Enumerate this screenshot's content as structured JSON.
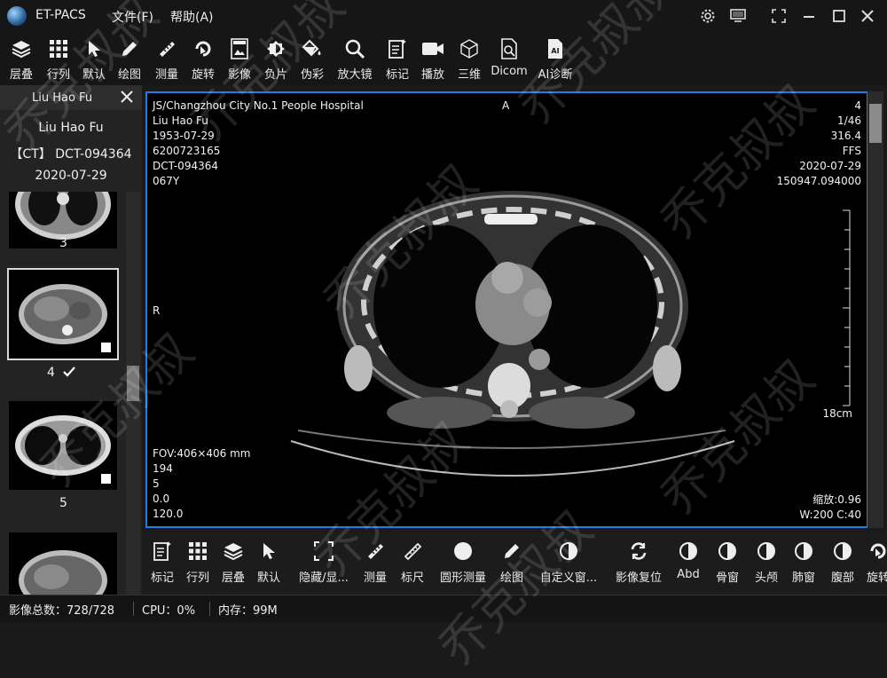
{
  "app": {
    "title": "ET-PACS",
    "menus": [
      "文件(F)",
      "帮助(A)"
    ]
  },
  "toolbar": {
    "items": [
      {
        "label": "层叠",
        "icon": "layers-icon"
      },
      {
        "label": "行列",
        "icon": "grid-icon"
      },
      {
        "label": "默认",
        "icon": "pointer-icon"
      },
      {
        "label": "绘图",
        "icon": "pencil-icon"
      },
      {
        "label": "测量",
        "icon": "measure-icon"
      },
      {
        "label": "旋转",
        "icon": "rotate-icon"
      },
      {
        "label": "影像",
        "icon": "dicom-image-icon"
      },
      {
        "label": "负片",
        "icon": "negative-icon"
      },
      {
        "label": "伪彩",
        "icon": "paint-bucket-icon"
      },
      {
        "label": "放大镜",
        "icon": "magnifier-icon"
      },
      {
        "label": "标记",
        "icon": "annotate-icon"
      },
      {
        "label": "播放",
        "icon": "video-icon"
      },
      {
        "label": "三维",
        "icon": "cube-icon"
      },
      {
        "label": "Dicom",
        "icon": "dicom-file-icon"
      },
      {
        "label": "AI诊断",
        "icon": "ai-icon"
      }
    ]
  },
  "patient": {
    "tab_name": "Liu Hao Fu",
    "name": "Liu Hao Fu",
    "modality_id": "【CT】 DCT-094364",
    "date": "2020-07-29"
  },
  "thumbnails": [
    {
      "number": "3",
      "selected": false
    },
    {
      "number": "4",
      "selected": true
    },
    {
      "number": "5",
      "selected": false
    },
    {
      "number": "",
      "selected": false
    }
  ],
  "overlay": {
    "top_left": [
      "JS/Changzhou City No.1 People Hospital",
      "Liu Hao Fu",
      "1953-07-29",
      "6200723165",
      "DCT-094364",
      "067Y"
    ],
    "top_right": [
      "4",
      "1/46",
      "316.4",
      "FFS",
      "2020-07-29",
      "150947.094000"
    ],
    "orient_top": "A",
    "orient_left": "R",
    "scale_label": "18cm",
    "bottom_left": [
      "FOV:406×406 mm",
      "194",
      "5",
      "0.0",
      "120.0"
    ],
    "bottom_right": [
      "缩放:0.96",
      "W:200 C:40"
    ]
  },
  "bottom_toolbar": {
    "items": [
      {
        "label": "标记",
        "icon": "annotate-icon"
      },
      {
        "label": "行列",
        "icon": "grid-icon"
      },
      {
        "label": "层叠",
        "icon": "layers-icon"
      },
      {
        "label": "默认",
        "icon": "pointer-icon"
      },
      {
        "label": "隐藏/显...",
        "icon": "hide-show-icon"
      },
      {
        "label": "测量",
        "icon": "measure-icon"
      },
      {
        "label": "标尺",
        "icon": "ruler-icon"
      },
      {
        "label": "圆形测量",
        "icon": "circle-measure-icon"
      },
      {
        "label": "绘图",
        "icon": "pencil-icon"
      },
      {
        "label": "自定义窗...",
        "icon": "window-level-icon"
      },
      {
        "label": "影像复位",
        "icon": "reset-icon"
      },
      {
        "label": "Abd",
        "icon": "window-level-icon"
      },
      {
        "label": "骨窗",
        "icon": "window-level-icon"
      },
      {
        "label": "头颅",
        "icon": "window-level-icon"
      },
      {
        "label": "肺窗",
        "icon": "window-level-icon"
      },
      {
        "label": "腹部",
        "icon": "window-level-icon"
      },
      {
        "label": "旋转",
        "icon": "rotate-icon"
      }
    ]
  },
  "status": {
    "total": "影像总数：728/728",
    "cpu": "CPU：0%",
    "memory": "内存：99M"
  },
  "watermark": "乔克叔叔",
  "colors": {
    "accent": "#1e7be8",
    "background": "#1a1a1a"
  }
}
